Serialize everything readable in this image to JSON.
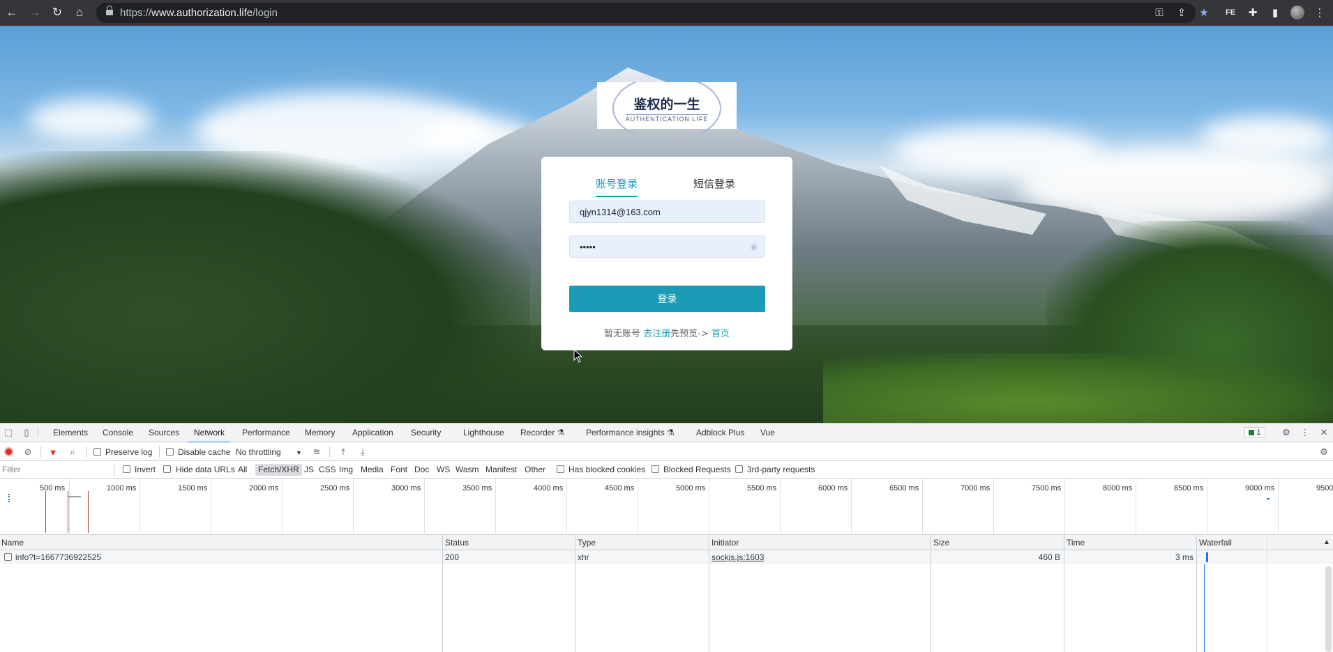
{
  "browser": {
    "url_scheme": "https://",
    "url_host": "www.authorization.life",
    "url_path": "/login",
    "ext_label": "FE"
  },
  "login_page": {
    "logo_title": "鉴权的一生",
    "logo_subtitle": "AUTHENTICATION LIFE",
    "tab_account": "账号登录",
    "tab_sms": "短信登录",
    "username_value": "qjyn1314@163.com",
    "password_mask": "•••••",
    "login_button": "登录",
    "footer_prefix": "暂无账号",
    "register_link": "去注册",
    "footer_middle": "先预览->",
    "home_link": "首页",
    "accent_color": "#1a9bb6"
  },
  "devtools": {
    "tabs": [
      "Elements",
      "Console",
      "Sources",
      "Network",
      "Performance",
      "Memory",
      "Application",
      "Security",
      "Lighthouse",
      "Recorder",
      "Performance insights",
      "Adblock Plus",
      "Vue"
    ],
    "active_tab": "Network",
    "issues_count": "1",
    "toolbar": {
      "preserve_log": "Preserve log",
      "disable_cache": "Disable cache",
      "throttling": "No throttling"
    },
    "filter": {
      "placeholder": "Filter",
      "invert": "Invert",
      "hide_data_urls": "Hide data URLs",
      "types": [
        "All",
        "Fetch/XHR",
        "JS",
        "CSS",
        "Img",
        "Media",
        "Font",
        "Doc",
        "WS",
        "Wasm",
        "Manifest",
        "Other"
      ],
      "selected_type": "Fetch/XHR",
      "has_blocked_cookies": "Has blocked cookies",
      "blocked_requests": "Blocked Requests",
      "third_party": "3rd-party requests"
    },
    "overview_ticks": [
      "500 ms",
      "1000 ms",
      "1500 ms",
      "2000 ms",
      "2500 ms",
      "3000 ms",
      "3500 ms",
      "4000 ms",
      "4500 ms",
      "5000 ms",
      "5500 ms",
      "6000 ms",
      "6500 ms",
      "7000 ms",
      "7500 ms",
      "8000 ms",
      "8500 ms",
      "9000 ms",
      "9500"
    ],
    "columns": [
      "Name",
      "Status",
      "Type",
      "Initiator",
      "Size",
      "Time",
      "Waterfall"
    ],
    "rows": [
      {
        "name": "info?t=1667736922525",
        "status": "200",
        "type": "xhr",
        "initiator": "sockjs.js:1603",
        "size": "460 B",
        "time": "3 ms"
      }
    ]
  }
}
